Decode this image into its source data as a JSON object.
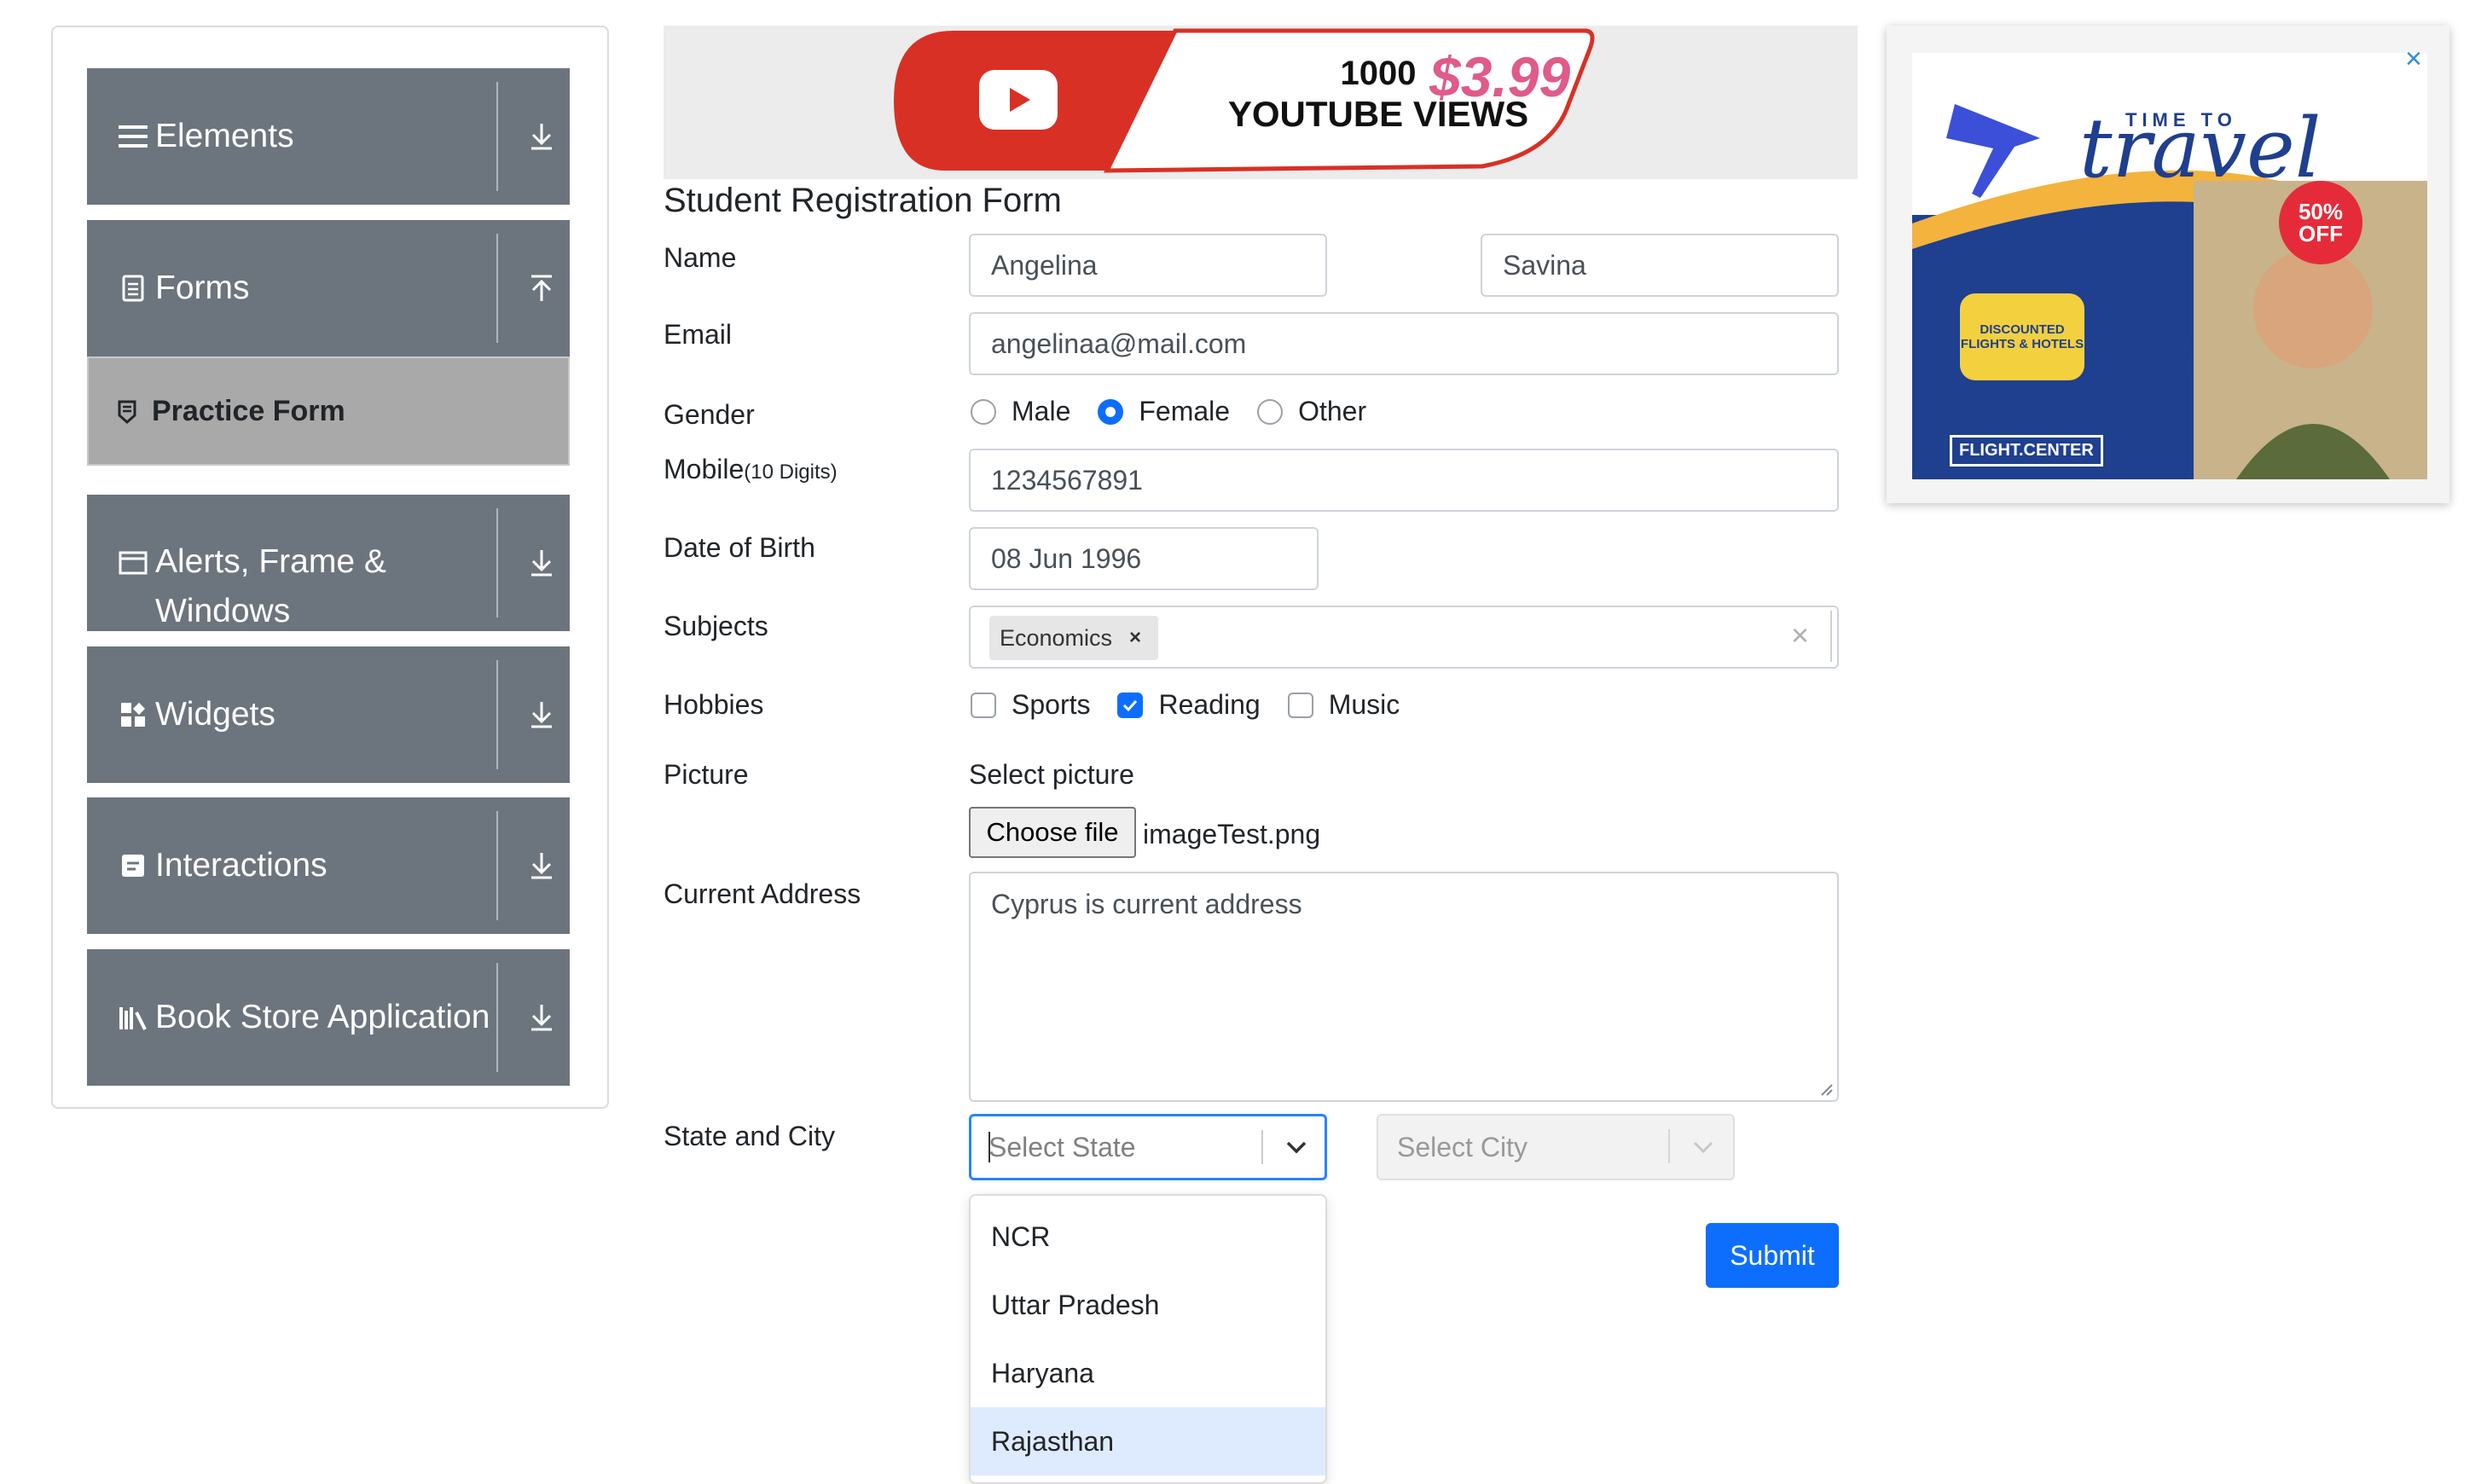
{
  "sidebar": {
    "groups": [
      {
        "label": "Elements",
        "icon": "hamburger-icon",
        "arrow": "download-arrow-icon"
      },
      {
        "label": "Forms",
        "icon": "document-icon",
        "arrow": "upload-arrow-icon"
      },
      {
        "label": "Alerts, Frame & Windows",
        "line1": "Alerts, Frame &",
        "line2": "Windows",
        "icon": "window-icon",
        "arrow": "download-arrow-icon"
      },
      {
        "label": "Widgets",
        "icon": "widgets-icon",
        "arrow": "download-arrow-icon"
      },
      {
        "label": "Interactions",
        "icon": "interactions-icon",
        "arrow": "download-arrow-icon"
      },
      {
        "label": "Book Store Application",
        "icon": "bookstore-icon",
        "arrow": "download-arrow-icon"
      }
    ],
    "active_item": {
      "label": "Practice Form",
      "icon": "clipboard-icon"
    }
  },
  "ad_banner": {
    "line1": "1000",
    "line2": "YOUTUBE VIEWS",
    "price": "$3.99",
    "logo": "youtube-play-icon"
  },
  "right_ad": {
    "title_small": "TIME TO",
    "title_big": "travel",
    "badge_pct": "50%",
    "badge_off": "OFF",
    "bubble_line1": "DISCOUNTED",
    "bubble_line2": "FLIGHTS & HOTELS",
    "brand": "FLIGHT.CENTER",
    "close": "×"
  },
  "form": {
    "title": "Student Registration Form",
    "name_label": "Name",
    "first_name": "Angelina",
    "last_name": "Savina",
    "email_label": "Email",
    "email": "angelinaa@mail.com",
    "gender_label": "Gender",
    "gender_options": [
      "Male",
      "Female",
      "Other"
    ],
    "gender_selected": "Female",
    "mobile_label": "Mobile",
    "mobile_hint": "(10 Digits)",
    "mobile": "1234567891",
    "dob_label": "Date of Birth",
    "dob": "08 Jun 1996",
    "subjects_label": "Subjects",
    "subject_chip": "Economics",
    "chip_remove": "×",
    "subjects_clear": "×",
    "hobbies_label": "Hobbies",
    "hobby_options": [
      "Sports",
      "Reading",
      "Music"
    ],
    "hobbies_checked": [
      "Reading"
    ],
    "picture_label": "Picture",
    "select_picture": "Select picture",
    "choose_file": "Choose file",
    "file_name": "imageTest.png",
    "address_label": "Current Address",
    "address": "Cyprus is current address",
    "state_city_label": "State and City",
    "state_placeholder": "Select State",
    "city_placeholder": "Select City",
    "state_options": [
      "NCR",
      "Uttar Pradesh",
      "Haryana",
      "Rajasthan"
    ],
    "highlighted_option": "Rajasthan",
    "submit": "Submit"
  },
  "colors": {
    "sidebar_bg": "#6c757d",
    "active_bg": "#a9a9a9",
    "primary": "#0d6efd",
    "option_highlight": "#deebff"
  }
}
